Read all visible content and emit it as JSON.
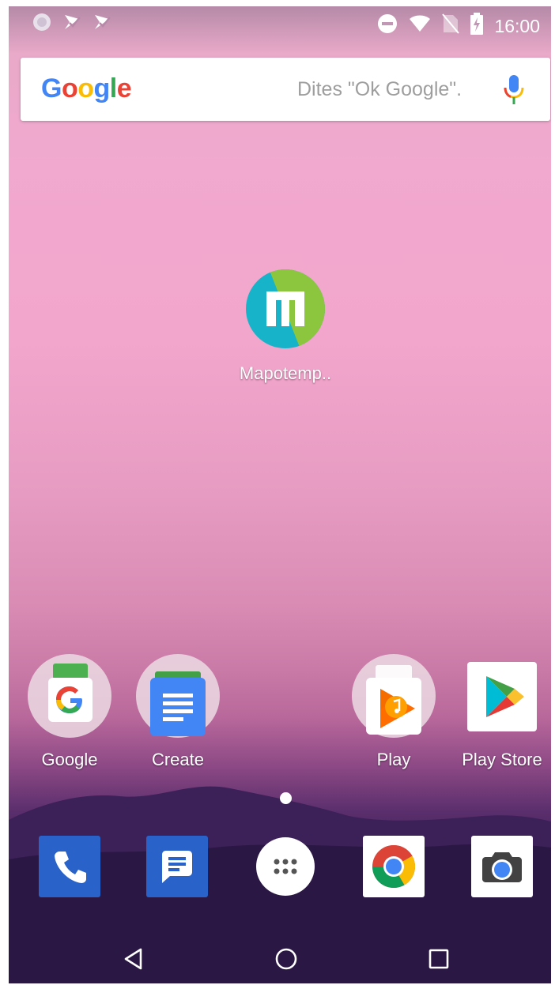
{
  "status_bar": {
    "time": "16:00",
    "left_icons": [
      "circle-notification-icon",
      "check-notification-icon",
      "check-notification-icon"
    ],
    "right_icons": [
      "do-not-disturb-icon",
      "wifi-icon",
      "no-sim-icon",
      "battery-charging-icon"
    ]
  },
  "search_bar": {
    "logo": "Google",
    "hint": "Dites \"Ok Google\"."
  },
  "home_apps": [
    {
      "label": "Mapotemp.."
    }
  ],
  "dock_row": [
    {
      "label": "Google"
    },
    {
      "label": "Create"
    },
    {
      "label": "Play"
    },
    {
      "label": "Play Store"
    }
  ],
  "hotseat": [
    "phone-icon",
    "messages-icon",
    "app-drawer-icon",
    "chrome-icon",
    "camera-icon"
  ],
  "nav": [
    "back-icon",
    "home-icon",
    "recents-icon"
  ]
}
